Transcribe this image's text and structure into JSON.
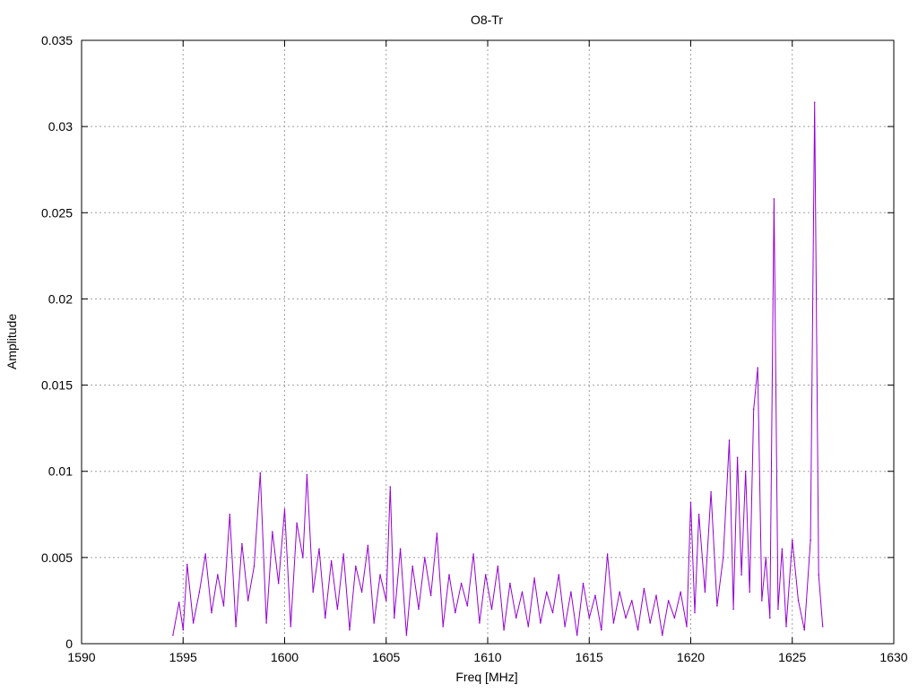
{
  "chart_data": {
    "type": "line",
    "title": "O8-Tr",
    "xlabel": "Freq [MHz]",
    "ylabel": "Amplitude",
    "xlim": [
      1590,
      1630
    ],
    "ylim": [
      0,
      0.035
    ],
    "x_ticks": [
      1590,
      1595,
      1600,
      1605,
      1610,
      1615,
      1620,
      1625,
      1630
    ],
    "x_tick_labels": [
      "1590",
      "1595",
      "1600",
      "1605",
      "1610",
      "1615",
      "1620",
      "1625",
      "1630"
    ],
    "y_ticks": [
      0,
      0.005,
      0.01,
      0.015,
      0.02,
      0.025,
      0.03,
      0.035
    ],
    "y_tick_labels": [
      "0",
      "0.005",
      "0.01",
      "0.015",
      "0.02",
      "0.025",
      "0.03",
      "0.035"
    ],
    "grid": true,
    "series_color": "#9400d3",
    "grid_color": "#a0a0a0",
    "series": [
      {
        "x": [
          1594.5,
          1594.8,
          1595.0,
          1595.2,
          1595.5,
          1595.8,
          1596.1,
          1596.4,
          1596.7,
          1597.0,
          1597.3,
          1597.6,
          1597.9,
          1598.2,
          1598.5,
          1598.8,
          1599.1,
          1599.4,
          1599.7,
          1600.0,
          1600.3,
          1600.6,
          1600.9,
          1601.1,
          1601.4,
          1601.7,
          1602.0,
          1602.3,
          1602.6,
          1602.9,
          1603.2,
          1603.5,
          1603.8,
          1604.1,
          1604.4,
          1604.7,
          1605.0,
          1605.2,
          1605.4,
          1605.7,
          1606.0,
          1606.3,
          1606.6,
          1606.9,
          1607.2,
          1607.5,
          1607.8,
          1608.1,
          1608.4,
          1608.7,
          1609.0,
          1609.3,
          1609.6,
          1609.9,
          1610.2,
          1610.5,
          1610.8,
          1611.1,
          1611.4,
          1611.7,
          1612.0,
          1612.3,
          1612.6,
          1612.9,
          1613.2,
          1613.5,
          1613.8,
          1614.1,
          1614.4,
          1614.7,
          1615.0,
          1615.3,
          1615.6,
          1615.9,
          1616.2,
          1616.5,
          1616.8,
          1617.1,
          1617.4,
          1617.7,
          1618.0,
          1618.3,
          1618.6,
          1618.9,
          1619.2,
          1619.5,
          1619.8,
          1620.0,
          1620.2,
          1620.4,
          1620.7,
          1621.0,
          1621.3,
          1621.6,
          1621.9,
          1622.1,
          1622.3,
          1622.5,
          1622.7,
          1622.9,
          1623.1,
          1623.3,
          1623.5,
          1623.7,
          1623.9,
          1624.1,
          1624.3,
          1624.5,
          1624.7,
          1625.0,
          1625.3,
          1625.6,
          1625.9,
          1626.1,
          1626.3,
          1626.5
        ],
        "y": [
          0.0005,
          0.0024,
          0.0008,
          0.0046,
          0.0012,
          0.003,
          0.0052,
          0.0018,
          0.004,
          0.0022,
          0.0075,
          0.001,
          0.0058,
          0.0025,
          0.0045,
          0.0099,
          0.0012,
          0.0065,
          0.0035,
          0.0078,
          0.001,
          0.007,
          0.005,
          0.0098,
          0.003,
          0.0055,
          0.0015,
          0.0048,
          0.002,
          0.0052,
          0.0008,
          0.0045,
          0.003,
          0.0057,
          0.0012,
          0.004,
          0.0025,
          0.0091,
          0.0015,
          0.0055,
          0.0005,
          0.0045,
          0.002,
          0.005,
          0.0028,
          0.0064,
          0.001,
          0.004,
          0.0018,
          0.0035,
          0.0022,
          0.0052,
          0.0012,
          0.004,
          0.002,
          0.0045,
          0.0008,
          0.0035,
          0.0015,
          0.003,
          0.001,
          0.0038,
          0.0012,
          0.003,
          0.0018,
          0.004,
          0.001,
          0.003,
          0.0005,
          0.0035,
          0.0015,
          0.0028,
          0.0008,
          0.0052,
          0.0012,
          0.003,
          0.0015,
          0.0025,
          0.0008,
          0.0032,
          0.0012,
          0.0028,
          0.0005,
          0.0025,
          0.0015,
          0.003,
          0.001,
          0.0082,
          0.0018,
          0.0075,
          0.003,
          0.0088,
          0.0022,
          0.005,
          0.0118,
          0.002,
          0.0108,
          0.004,
          0.01,
          0.003,
          0.0136,
          0.016,
          0.0025,
          0.005,
          0.0015,
          0.0258,
          0.002,
          0.0055,
          0.001,
          0.006,
          0.0025,
          0.0008,
          0.006,
          0.0314,
          0.004,
          0.001
        ]
      }
    ]
  }
}
